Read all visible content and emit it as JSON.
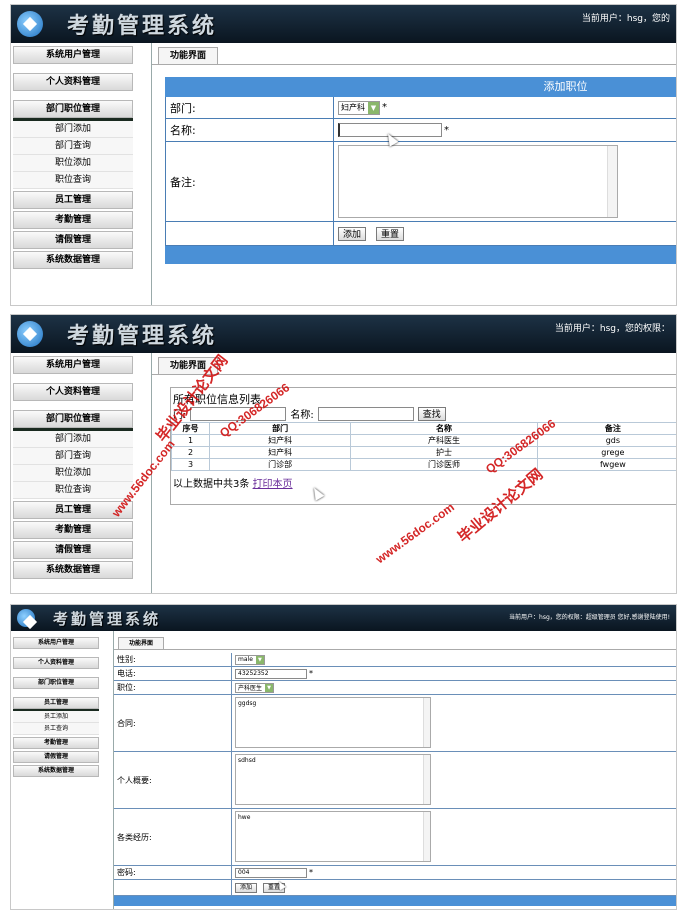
{
  "app_title": "考勤管理系统",
  "screens": [
    {
      "user_text": "当前用户：hsg，您的",
      "menu": [
        "系统用户管理",
        "个人资料管理",
        "部门职位管理"
      ],
      "submenu": [
        "部门添加",
        "部门查询",
        "职位添加",
        "职位查询"
      ],
      "menu_after": [
        "员工管理",
        "考勤管理",
        "请假管理",
        "系统数据管理"
      ],
      "tab": "功能界面",
      "form_title": "添加职位",
      "fields": {
        "dept_label": "部门:",
        "dept_value": "妇产科",
        "name_label": "名称:",
        "notes_label": "备注:",
        "required": "*"
      },
      "add_button": "添加",
      "reset_button": "重置"
    },
    {
      "user_text": "当前用户：hsg，您的权限：",
      "menu": [
        "系统用户管理",
        "个人资料管理",
        "部门职位管理"
      ],
      "submenu": [
        "部门添加",
        "部门查询",
        "职位添加",
        "职位查询"
      ],
      "menu_after": [
        "员工管理",
        "考勤管理",
        "请假管理",
        "系统数据管理"
      ],
      "tab": "功能界面",
      "list_title": "所有职位信息列表",
      "search_dept_label": "门:",
      "search_name_label": "名称:",
      "search_button": "查找",
      "columns": [
        "序号",
        "部门",
        "名称",
        "备注"
      ],
      "rows": [
        [
          "1",
          "妇产科",
          "产科医生",
          "gds"
        ],
        [
          "2",
          "妇产科",
          "护士",
          "grege"
        ],
        [
          "3",
          "门诊部",
          "门诊医师",
          "fwgew"
        ]
      ],
      "footer_text": "以上数据中共3条",
      "print_link": "打印本页",
      "watermarks": [
        "毕业设计论文网",
        "www.56doc.com",
        "QQ:306826066",
        "毕业设计论文网",
        "www.56doc.com",
        "QQ:306826066"
      ]
    },
    {
      "user_text": "当前用户：hsg，您的权限：超级管理员  您好,感谢登陆使用!",
      "menu": [
        "系统用户管理",
        "个人资料管理",
        "部门职位管理",
        "员工管理"
      ],
      "submenu": [
        "员工添加",
        "员工查询"
      ],
      "menu_after": [
        "考勤管理",
        "请假管理",
        "系统数据管理"
      ],
      "tab": "功能界面",
      "fields": {
        "gender_label": "性别:",
        "gender_value": "male",
        "phone_label": "电话:",
        "phone_value": "43252352",
        "position_label": "职位:",
        "position_value": "产科医生",
        "contract_label": "合同:",
        "contract_value": "ggdsg",
        "profile_label": "个人概要:",
        "profile_value": "sdhsd",
        "experience_label": "各类经历:",
        "experience_value": "hwe",
        "password_label": "密码:",
        "password_value": "004",
        "required": "*"
      },
      "add_button": "添加",
      "reset_button": "重置"
    }
  ]
}
